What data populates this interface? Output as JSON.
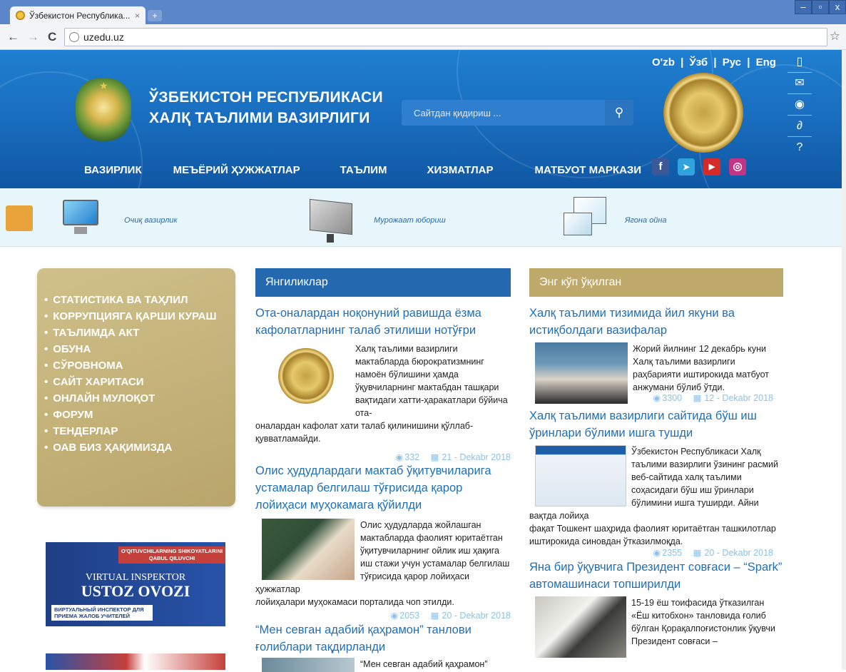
{
  "browser": {
    "tab_title": "Ўзбекистон Республика...",
    "tab_close": "×",
    "new_tab": "+",
    "win_minimize": "–",
    "win_maximize": "▫",
    "win_close": "x",
    "back": "←",
    "forward": "→",
    "reload": "C",
    "url": "uzedu.uz",
    "star": "☆"
  },
  "header": {
    "title_line1": "ЎЗБЕКИСТОН РЕСПУБЛИКАСИ",
    "title_line2": "ХАЛҚ ТАЪЛИМИ ВАЗИРЛИГИ",
    "search_placeholder": "Сайтдан қидириш ...",
    "search_icon": "search-icon",
    "langs": [
      "O'zb",
      "|",
      "Ўзб",
      "|",
      "Рус",
      "|",
      "Eng"
    ],
    "nav": [
      "ВАЗИРЛИК",
      "МЕЪЁРИЙ ҲУЖЖАТЛАР",
      "ТАЪЛИМ",
      "ХИЗМАТЛАР",
      "МАТБУОТ МАРКАЗИ"
    ],
    "social": [
      {
        "icon": "facebook-icon",
        "glyph": "f",
        "color": "#3b5998"
      },
      {
        "icon": "telegram-icon",
        "glyph": "➤",
        "color": "#2ea3dd"
      },
      {
        "icon": "youtube-icon",
        "glyph": "▶",
        "color": "#d42a2a"
      },
      {
        "icon": "instagram-icon",
        "glyph": "◎",
        "color": "#c13584"
      }
    ],
    "side_icons": [
      {
        "icon": "mobile-icon",
        "glyph": "▯"
      },
      {
        "icon": "mail-icon",
        "glyph": "✉"
      },
      {
        "icon": "eye-icon",
        "glyph": "◉"
      },
      {
        "icon": "link-icon",
        "glyph": "∂"
      },
      {
        "icon": "help-icon",
        "glyph": "?"
      }
    ]
  },
  "quicklinks": [
    "Очиқ вазирлик",
    "Мурожаат юбориш",
    "Ягона ойна"
  ],
  "left_menu": [
    "СТАТИСТИКА ВА ТАҲЛИЛ",
    "КОРРУПЦИЯГА ҚАРШИ КУРАШ",
    "ТАЪЛИМДА АКТ",
    "ОБУНА",
    "СЎРОВНОМА",
    "САЙТ ХАРИТАСИ",
    "ОНЛАЙН МУЛОҚОТ",
    "ФОРУМ",
    "ТЕНДЕРЛАР",
    "ОАВ БИЗ ҲАҚИМИЗДА"
  ],
  "banner": {
    "top": "O'QITUVCHILARNING SHIKOYATLARINI QABUL QILUVCHI",
    "line1": "VIRTUAL INSPEKTOR",
    "line2": "USTOZ OVOZI",
    "bottom": "ВИРТУАЛЬНЫЙ ИНСПЕКТОР ДЛЯ ПРИЕМА ЖАЛОБ УЧИТЕЛЕЙ"
  },
  "news": {
    "heading": "Янгиликлар",
    "items": [
      {
        "title": "Ота-оналардан ноқонуний равишда ёзма кафолатларнинг талаб этилиши нотўғри",
        "body_side": "Халқ таълими вазирлиги мактабларда бюрократизмнинг намоён бўлишини ҳамда ўқувчиларнинг мактабдан ташқари вақтидаги хатти-ҳаракатлари бўйича ота-",
        "body_rest": "оналардан кафолат хати талаб қилинишини қўллаб-қувватламайди.",
        "views": "332",
        "date": "21 - Dekabr 2018"
      },
      {
        "title": "Олис ҳудудлардаги мактаб ўқитувчиларига устамалар белгилаш тўғрисида қарор лойиҳаси муҳокамага қўйилди",
        "body_side": "Олис ҳудудларда жойлашган мактабларда фаолият юритаётган ўқитувчиларнинг ойлик иш ҳақига иш стажи учун устамалар белгилаш тўғрисида қарор лойиҳаси ҳужжатлар",
        "body_rest": "лойиҳалари муҳокамаси порталида чоп этилди.",
        "views": "2053",
        "date": "20 - Dekabr 2018"
      },
      {
        "title": "“Мен севган адабий қаҳрамон” танлови ғолиблари тақдирланди",
        "body_side": "“Мен севган адабий қаҳрамон”"
      }
    ]
  },
  "popular": {
    "heading": "Энг кўп ўқилган",
    "items": [
      {
        "title": "Халқ таълими тизимида йил якуни ва истиқболдаги вазифалар",
        "body_side": "Жорий йилнинг 12 декабрь куни Халқ таълими вазирлиги раҳбарияти иштирокида матбуот анжумани бўлиб ўтди.",
        "views": "3300",
        "date": "12 - Dekabr 2018"
      },
      {
        "title": "Халқ таълими вазирлиги сайтида бўш иш ўринлари бўлими ишга тушди",
        "body_side": "Ўзбекистон Республикаси Халқ таълими вазирлиги ўзининг расмий веб-сайтида халқ таълими соҳасидаги бўш иш ўринлари бўлимини ишга туширди. Айни вақтда лойиҳа",
        "body_rest": "фақат Тошкент шаҳрида фаолият юритаётган ташкилотлар иштирокида синовдан ўтказилмоқда.",
        "views": "2355",
        "date": "20 - Dekabr 2018"
      },
      {
        "title": "Яна бир ўқувчига Президент совғаси – “Spark” автомашинаси топширилди",
        "body_side": "15-19 ёш тоифасида ўтказилган «Ёш китобхон» танловида ғолиб бўлган Қорақалпоғистонлик ўқувчи Президент совғаси –"
      }
    ]
  },
  "colors": {
    "header_blue": "#1a6fc0",
    "news_head": "#2468b0",
    "popular_head": "#bfa96a",
    "link": "#1e6fb5",
    "meta": "#8fc1e6"
  }
}
